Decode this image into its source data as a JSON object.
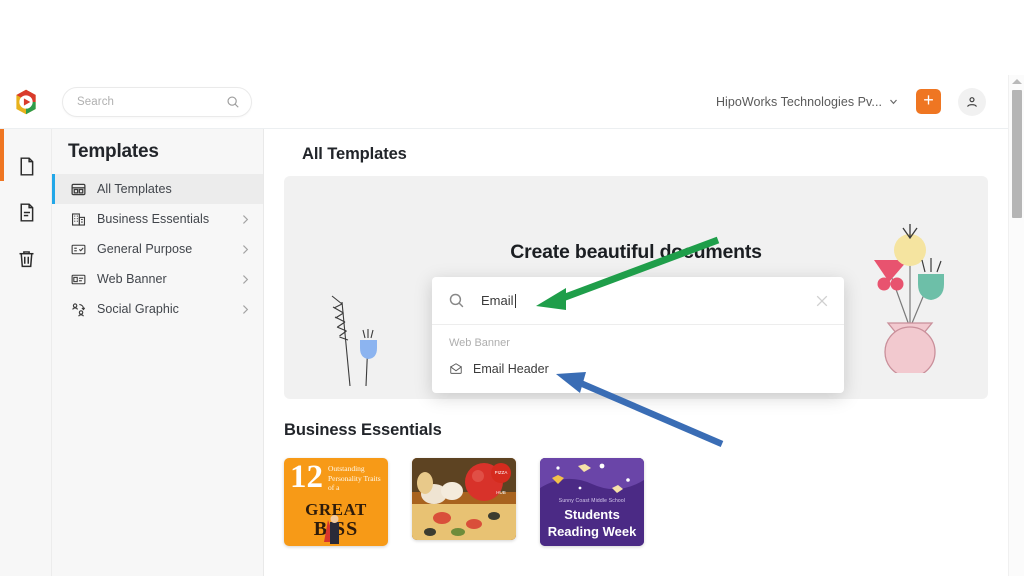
{
  "app": {
    "logo_icon": "hexagon-play-logo",
    "accent_orange": "#ef7622",
    "accent_blue": "#22a7e8"
  },
  "topbar": {
    "search_placeholder": "Search",
    "search_value": "",
    "search_icon": "search-icon",
    "org_name": "HipoWorks Technologies Pv...",
    "caret_icon": "chevron-down-icon",
    "create_label": "+",
    "account_icon": "user-icon"
  },
  "rail": {
    "items": [
      {
        "icon": "document-blank-icon",
        "name": "documents"
      },
      {
        "icon": "document-lines-icon",
        "name": "my-files"
      },
      {
        "icon": "trash-icon",
        "name": "trash"
      }
    ]
  },
  "sidebar": {
    "title": "Templates",
    "items": [
      {
        "label": "All Templates",
        "icon": "grid-panel-icon",
        "active": true,
        "chevron": false
      },
      {
        "label": "Business Essentials",
        "icon": "building-icon",
        "active": false,
        "chevron": true
      },
      {
        "label": "General Purpose",
        "icon": "checklist-icon",
        "active": false,
        "chevron": true
      },
      {
        "label": "Web Banner",
        "icon": "banner-icon",
        "active": false,
        "chevron": true
      },
      {
        "label": "Social Graphic",
        "icon": "people-share-icon",
        "active": false,
        "chevron": true
      }
    ]
  },
  "main": {
    "page_title": "All Templates",
    "hero": {
      "heading": "Create beautiful documents",
      "art_left": "wheat-and-tulip-illustration",
      "art_right": "flower-vase-illustration"
    },
    "section_title": "Business Essentials",
    "cards": [
      {
        "name": "great-boss-template",
        "number": "12",
        "subtitle": "Outstanding Personality Traits of a",
        "line1": "GREAT",
        "line2": "B SS"
      },
      {
        "name": "pizza-template",
        "badge": "PIZZA HUB"
      },
      {
        "name": "students-reading-week-template",
        "school": "Sunny Coast Middle School",
        "line1": "Students",
        "line2": "Reading Week"
      }
    ]
  },
  "search_overlay": {
    "search_icon": "search-icon",
    "value": "Email",
    "placeholder": "Search",
    "close_icon": "close-icon",
    "group_label": "Web Banner",
    "results": [
      {
        "label": "Email Header",
        "icon": "envelope-icon"
      }
    ]
  },
  "annotations": {
    "green_arrow": {
      "name": "green-arrow-to-search-input",
      "color": "#1f9e4a"
    },
    "blue_arrow": {
      "name": "blue-arrow-to-email-header",
      "color": "#3a6db5"
    }
  },
  "scrollbar": {
    "up_arrow_icon": "scroll-up-arrow-icon"
  }
}
